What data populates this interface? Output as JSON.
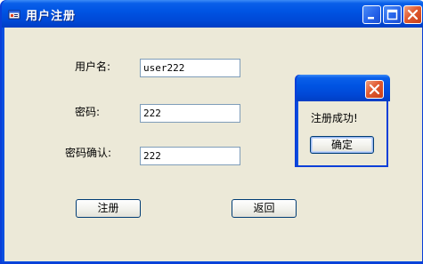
{
  "window": {
    "title": "用户注册",
    "accent": "#0054e3",
    "close_color": "#e05a30",
    "icons": [
      "minimize-icon",
      "maximize-icon",
      "close-icon"
    ]
  },
  "form": {
    "username_label": "用户名:",
    "username_value": "user222",
    "password_label": "密码:",
    "password_value": "222",
    "confirm_label": "密码确认:",
    "confirm_value": "222",
    "register_button": "注册",
    "back_button": "返回"
  },
  "dialog": {
    "message": "注册成功!",
    "ok_button": "确定"
  }
}
